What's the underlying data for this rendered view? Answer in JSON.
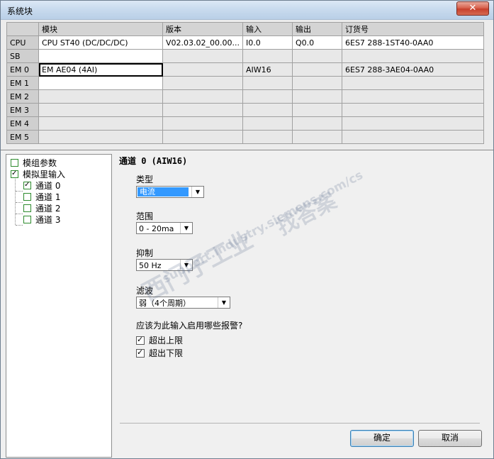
{
  "window": {
    "title": "系统块",
    "close_glyph": "✕"
  },
  "table": {
    "headers": [
      "",
      "模块",
      "版本",
      "输入",
      "输出",
      "订货号"
    ],
    "rows": [
      [
        "CPU",
        "CPU ST40 (DC/DC/DC)",
        "V02.03.02_00.00...",
        "I0.0",
        "Q0.0",
        "6ES7 288-1ST40-0AA0"
      ],
      [
        "SB",
        "",
        "",
        "",
        "",
        ""
      ],
      [
        "EM 0",
        "EM AE04 (4AI)",
        "",
        "AIW16",
        "",
        "6ES7 288-3AE04-0AA0"
      ],
      [
        "EM 1",
        "",
        "",
        "",
        "",
        ""
      ],
      [
        "EM 2",
        "",
        "",
        "",
        "",
        ""
      ],
      [
        "EM 3",
        "",
        "",
        "",
        "",
        ""
      ],
      [
        "EM 4",
        "",
        "",
        "",
        "",
        ""
      ],
      [
        "EM 5",
        "",
        "",
        "",
        "",
        ""
      ]
    ]
  },
  "tree": {
    "items": [
      {
        "label": "模组参数",
        "checked": false
      },
      {
        "label": "模拟里输入",
        "checked": true
      },
      {
        "label": "通道 0",
        "checked": true
      },
      {
        "label": "通道 1",
        "checked": false
      },
      {
        "label": "通道 2",
        "checked": false
      },
      {
        "label": "通道 3",
        "checked": false
      }
    ]
  },
  "panel": {
    "heading": "通道 0 (AIW16)",
    "type_label": "类型",
    "type_value": "电流",
    "range_label": "范围",
    "range_value": "0 - 20ma",
    "suppress_label": "抑制",
    "suppress_value": "50 Hz",
    "filter_label": "滤波",
    "filter_value": "弱（4个周期）",
    "alarm_question": "应该为此输入启用哪些报警?",
    "alarms": [
      {
        "label": "超出上限",
        "checked": true
      },
      {
        "label": "超出下限",
        "checked": true
      }
    ]
  },
  "buttons": {
    "ok": "确定",
    "cancel": "取消"
  },
  "watermark": {
    "line1": "西门子工业",
    "line2": "support.industry.siemens.com/cs",
    "line3": "找答案"
  },
  "colors": {
    "selection": "#3399ff",
    "close": "#c7402c",
    "tree_check": "#2e8b2e"
  }
}
